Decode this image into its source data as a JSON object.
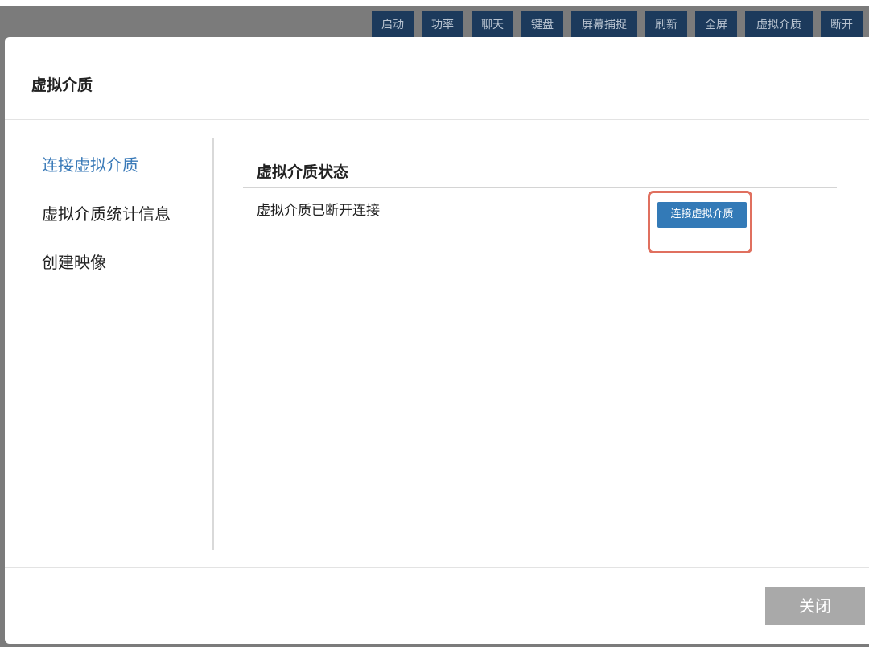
{
  "toolbar": {
    "buttons": [
      "启动",
      "功率",
      "聊天",
      "键盘",
      "屏幕捕捉",
      "刷新",
      "全屏",
      "虚拟介质",
      "断开"
    ]
  },
  "modal": {
    "title": "虚拟介质",
    "sidebar": {
      "items": [
        "连接虚拟介质",
        "虚拟介质统计信息",
        "创建映像"
      ],
      "active_index": 0
    },
    "section": {
      "title": "虚拟介质状态",
      "status": "虚拟介质已断开连接",
      "connect_button": "连接虚拟介质"
    },
    "close_button": "关闭"
  },
  "colors": {
    "overlay": "#7b7b7b",
    "toolbar_button": "#1c3a5c",
    "active_link": "#3a7ab8",
    "primary_button": "#337ab7",
    "highlight": "#e0705f",
    "close_button": "#a9a9a9"
  }
}
